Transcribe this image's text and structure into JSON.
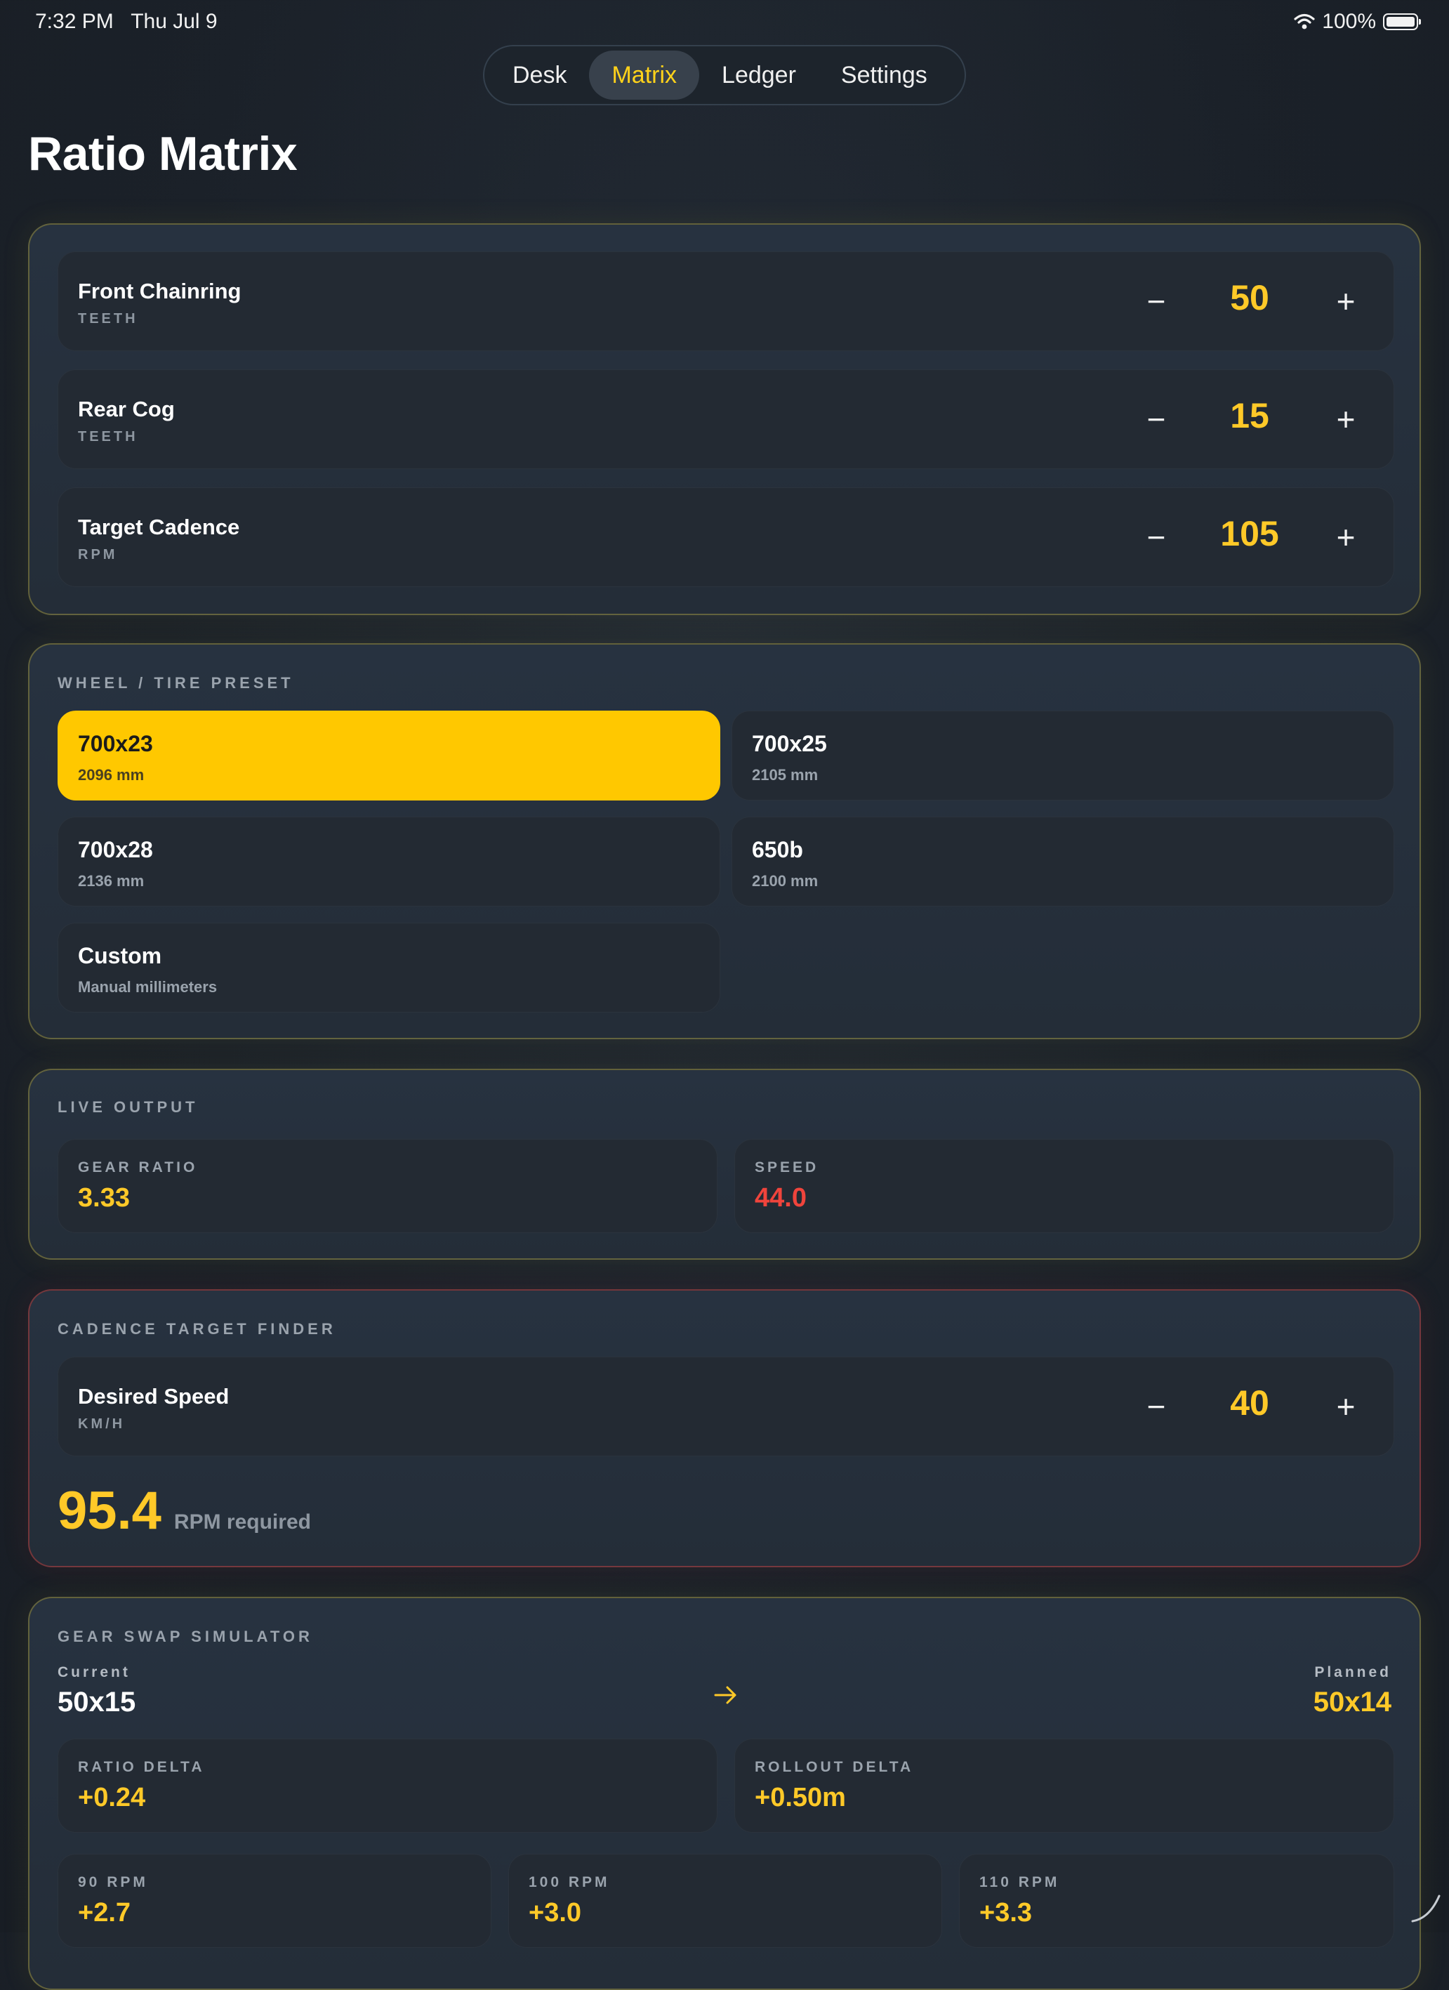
{
  "status_bar": {
    "time": "7:32 PM",
    "date": "Thu Jul 9",
    "battery": "100%"
  },
  "tabs": [
    {
      "label": "Desk",
      "active": false
    },
    {
      "label": "Matrix",
      "active": true
    },
    {
      "label": "Ledger",
      "active": false
    },
    {
      "label": "Settings",
      "active": false
    }
  ],
  "page_title": "Ratio Matrix",
  "steppers": [
    {
      "label": "Front Chainring",
      "unit": "TEETH",
      "value": "50"
    },
    {
      "label": "Rear Cog",
      "unit": "TEETH",
      "value": "15"
    },
    {
      "label": "Target Cadence",
      "unit": "RPM",
      "value": "105"
    }
  ],
  "wheel": {
    "title": "WHEEL / TIRE PRESET",
    "presets": [
      {
        "name": "700x23",
        "size": "2096 mm",
        "selected": true
      },
      {
        "name": "700x25",
        "size": "2105 mm",
        "selected": false
      },
      {
        "name": "700x28",
        "size": "2136 mm",
        "selected": false
      },
      {
        "name": "650b",
        "size": "2100 mm",
        "selected": false
      },
      {
        "name": "Custom",
        "size": "Manual millimeters",
        "selected": false
      }
    ]
  },
  "live_output": {
    "title": "LIVE OUTPUT",
    "gear_ratio_label": "GEAR RATIO",
    "gear_ratio": "3.33",
    "speed_label": "SPEED",
    "speed": "44.0"
  },
  "cadence_finder": {
    "title": "CADENCE TARGET FINDER",
    "desired_label": "Desired Speed",
    "desired_unit": "KM/H",
    "desired_value": "40",
    "result": "95.4",
    "result_suffix": "RPM required"
  },
  "swap": {
    "title": "GEAR SWAP SIMULATOR",
    "current_label": "Current",
    "current": "50x15",
    "planned_label": "Planned",
    "planned": "50x14",
    "ratio_delta_label": "RATIO DELTA",
    "ratio_delta": "+0.24",
    "rollout_delta_label": "ROLLOUT DELTA",
    "rollout_delta": "+0.50m",
    "rpm": [
      {
        "label": "90 RPM",
        "value": "+2.7"
      },
      {
        "label": "100 RPM",
        "value": "+3.0"
      },
      {
        "label": "110 RPM",
        "value": "+3.3"
      }
    ]
  },
  "colors": {
    "accent": "#ffc800",
    "speed": "#f0443c",
    "background": "#1b2129"
  }
}
